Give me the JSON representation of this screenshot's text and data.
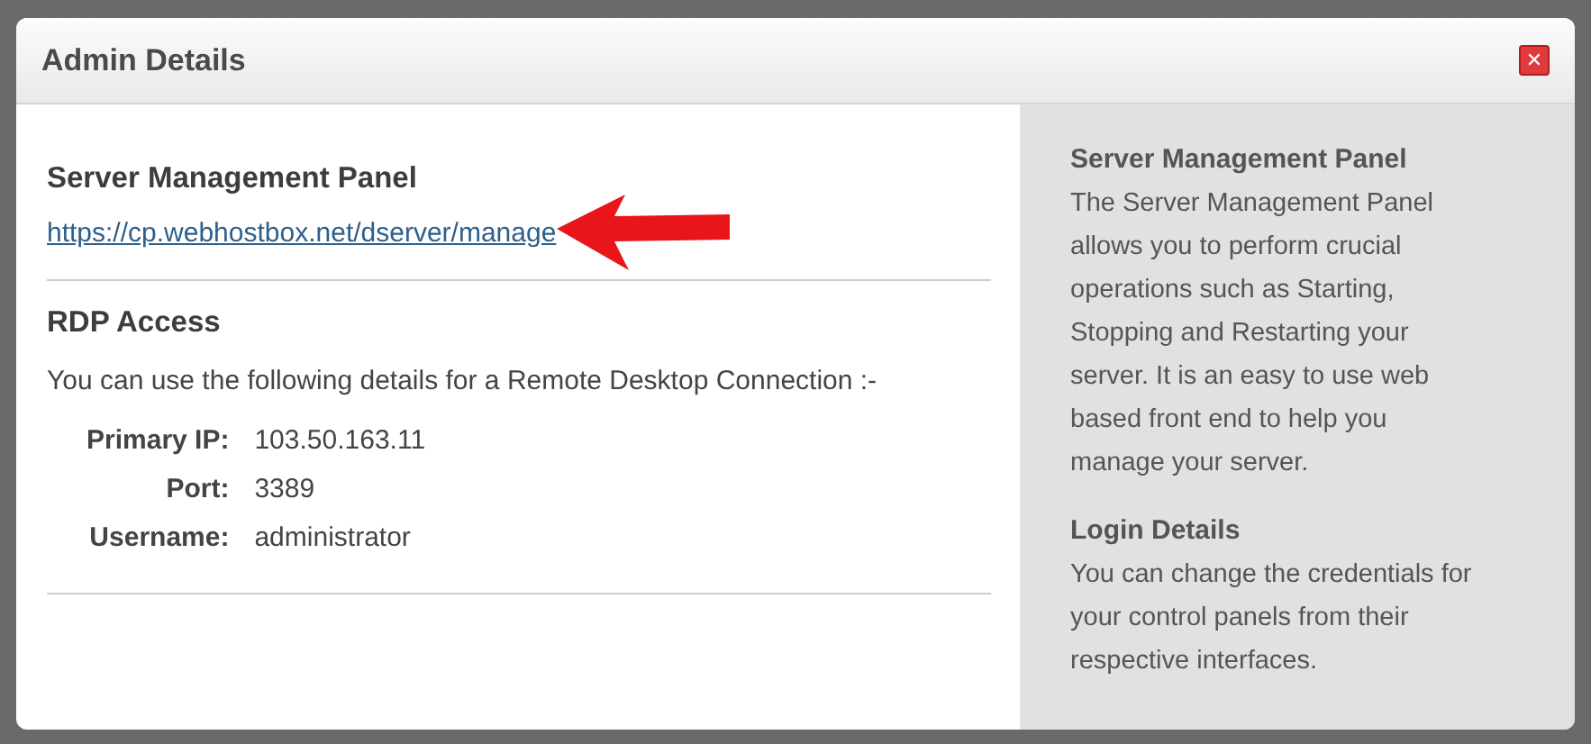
{
  "window": {
    "title": "Admin Details",
    "close": "✕"
  },
  "server_panel": {
    "heading": "Server Management Panel",
    "link": "https://cp.webhostbox.net/dserver/manage"
  },
  "rdp": {
    "heading": "RDP Access",
    "intro": "You can use the following details for a Remote Desktop Connection :-",
    "fields": [
      {
        "label": "Primary IP:",
        "value": "103.50.163.11"
      },
      {
        "label": "Port:",
        "value": "3389"
      },
      {
        "label": "Username:",
        "value": "administrator"
      }
    ]
  },
  "help": [
    {
      "heading": "Server Management Panel",
      "text": "The Server Management Panel allows you to perform crucial operations such as Starting, Stopping and Restarting your server. It is an easy to use web based front end to help you manage your server."
    },
    {
      "heading": "Login Details",
      "text": "You can change the credentials for your control panels from their respective interfaces."
    }
  ]
}
